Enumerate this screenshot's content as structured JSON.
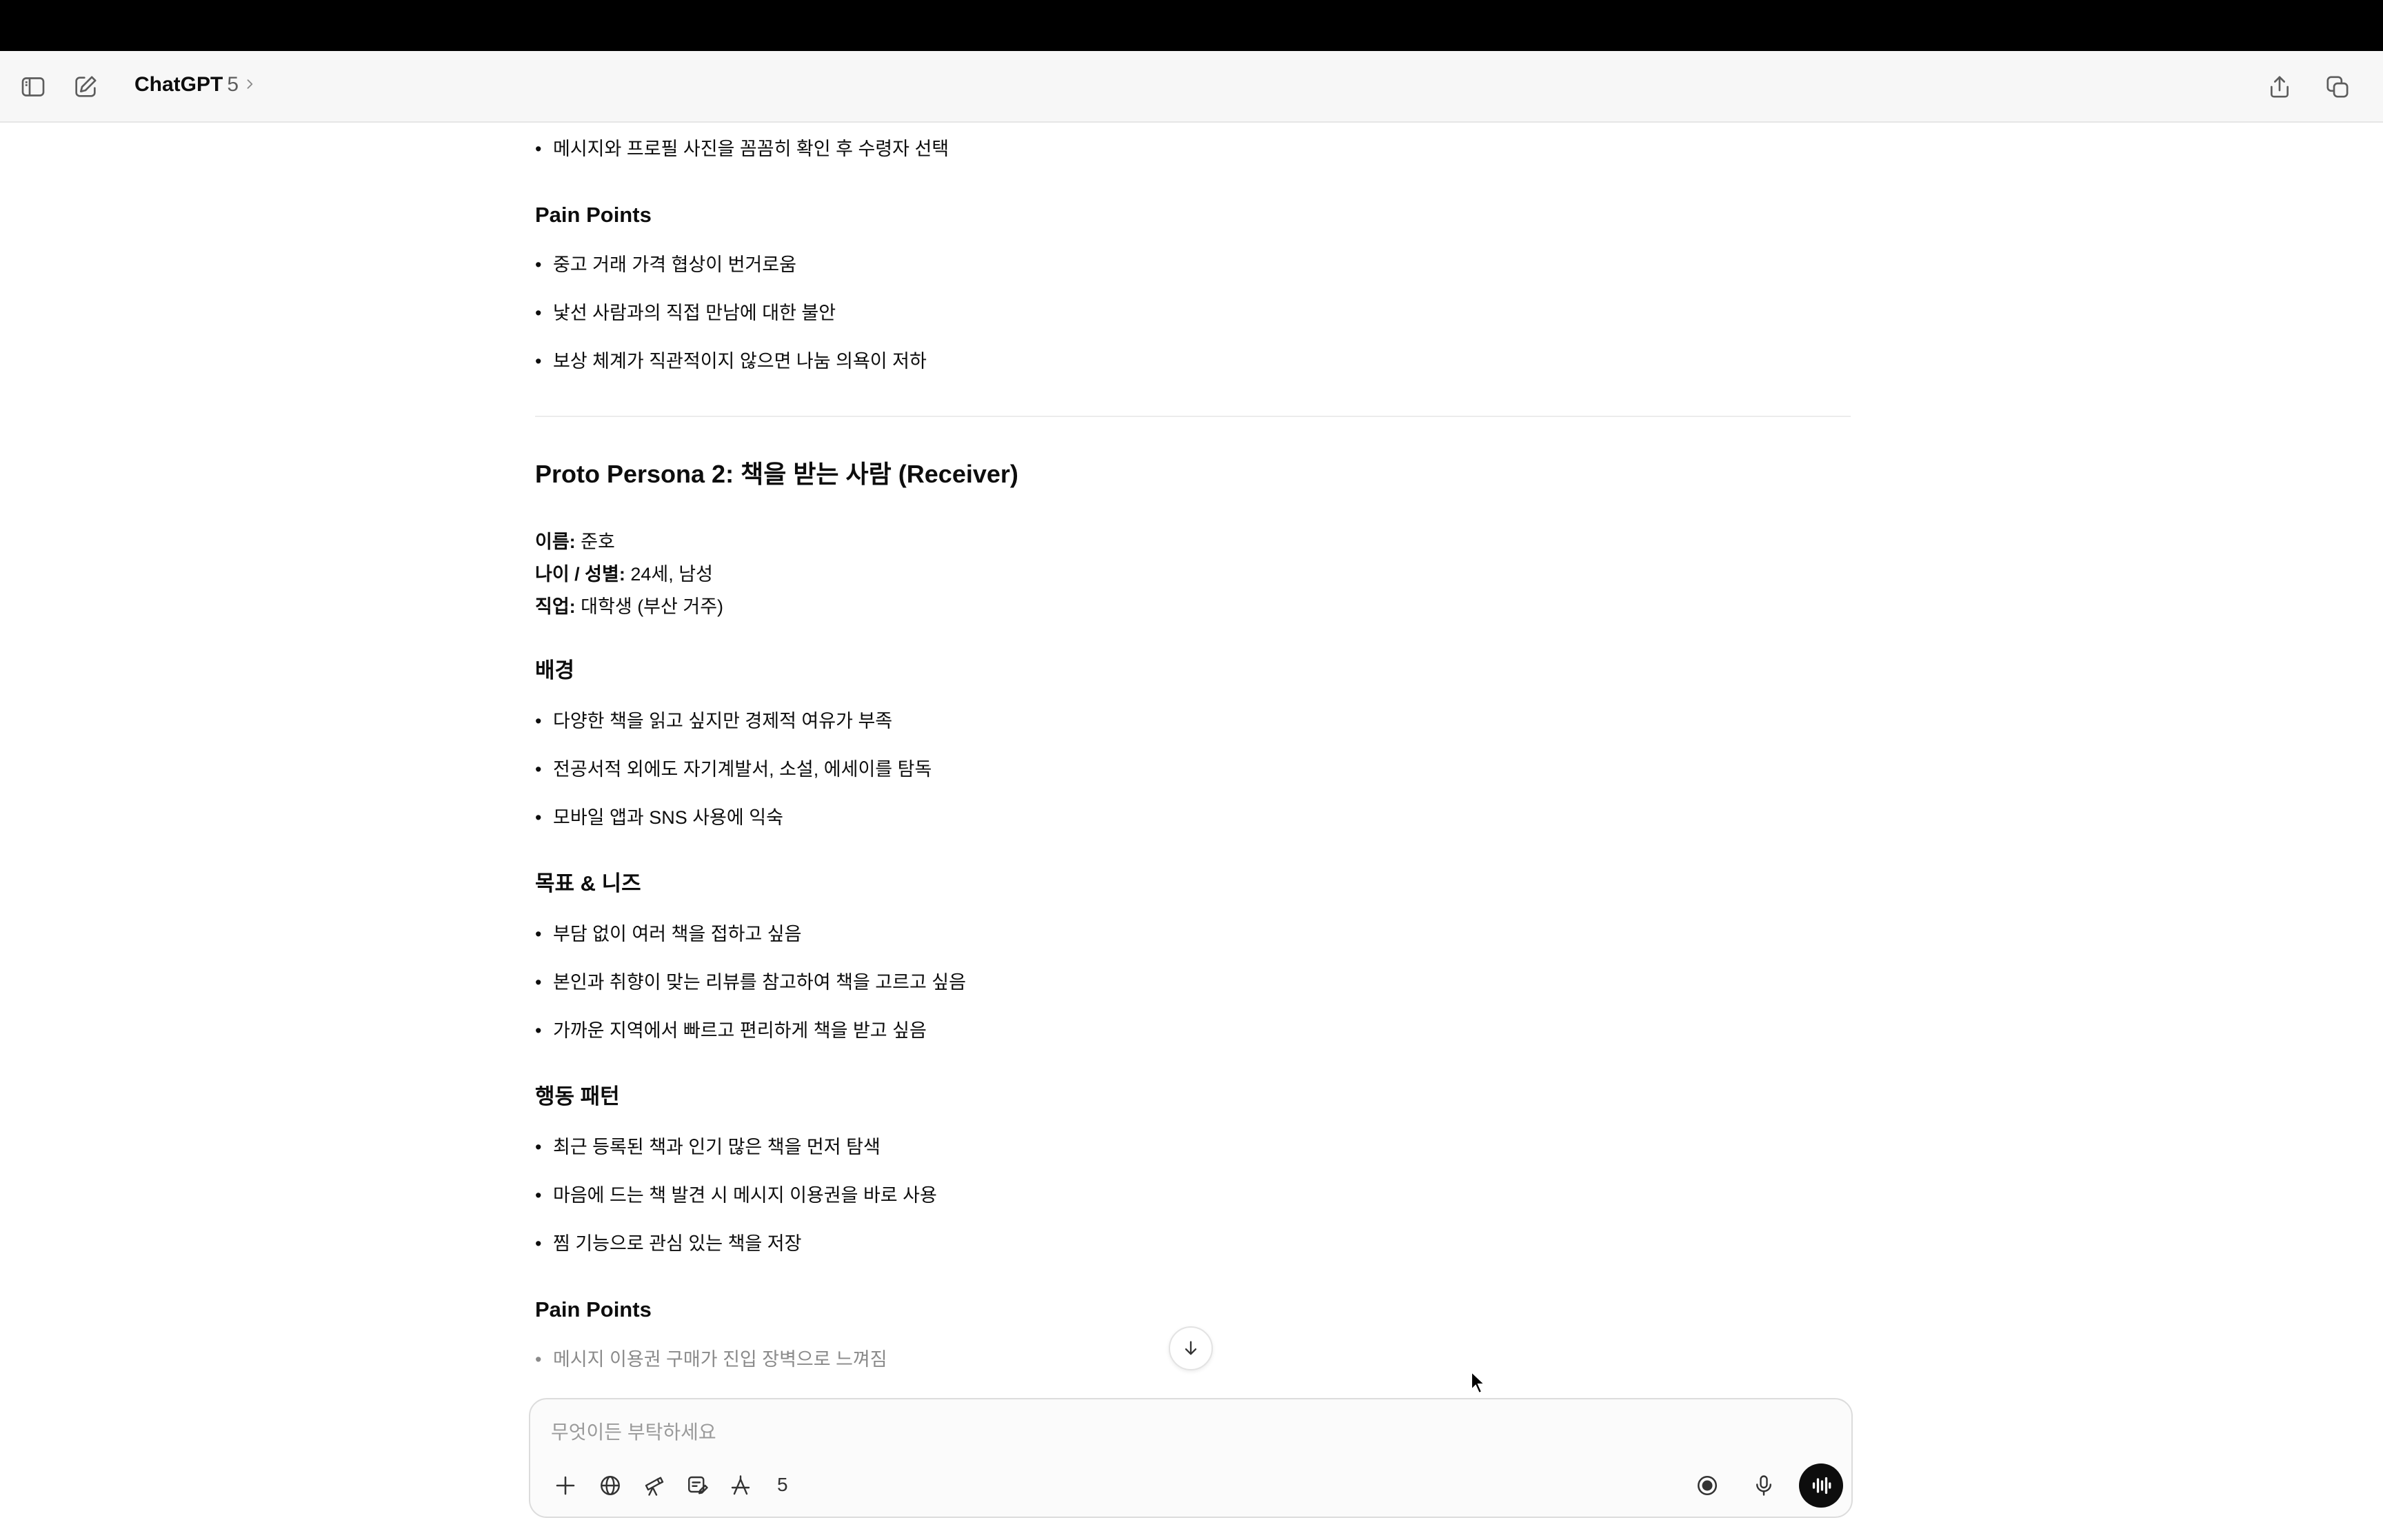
{
  "header": {
    "model_name": "ChatGPT",
    "model_version": "5",
    "icons": [
      "sidebar-toggle-icon",
      "new-chat-icon",
      "chevron-right-icon",
      "share-icon",
      "temporary-chat-icon"
    ]
  },
  "content": {
    "top_bullet": "메시지와 프로필 사진을 꼼꼼히 확인 후 수령자 선택",
    "pain_points_1": {
      "heading": "Pain Points",
      "items": [
        "중고 거래 가격 협상이 번거로움",
        "낯선 사람과의 직접 만남에 대한 불안",
        "보상 체계가 직관적이지 않으면 나눔 의욕이 저하"
      ]
    },
    "persona2": {
      "title": "Proto Persona 2: 책을 받는 사람 (Receiver)",
      "name_label": "이름:",
      "name_value": " 준호",
      "age_label": "나이 / 성별:",
      "age_value": " 24세, 남성",
      "job_label": "직업:",
      "job_value": " 대학생 (부산 거주)"
    },
    "background": {
      "heading": "배경",
      "items": [
        "다양한 책을 읽고 싶지만 경제적 여유가 부족",
        "전공서적 외에도 자기계발서, 소설, 에세이를 탐독",
        "모바일 앱과 SNS 사용에 익숙"
      ]
    },
    "goals": {
      "heading": "목표 & 니즈",
      "items": [
        "부담 없이 여러 책을 접하고 싶음",
        "본인과 취향이 맞는 리뷰를 참고하여 책을 고르고 싶음",
        "가까운 지역에서 빠르고 편리하게 책을 받고 싶음"
      ]
    },
    "behavior": {
      "heading": "행동 패턴",
      "items": [
        "최근 등록된 책과 인기 많은 책을 먼저 탐색",
        "마음에 드는 책 발견 시 메시지 이용권을 바로 사용",
        "찜 기능으로 관심 있는 책을 저장"
      ]
    },
    "pain_points_2": {
      "heading": "Pain Points",
      "items": [
        "메시지 이용권 구매가 진입 장벽으로 느껴짐"
      ]
    }
  },
  "composer": {
    "placeholder": "무엇이든 부탁하세요",
    "value": "",
    "tool_count": "5"
  }
}
